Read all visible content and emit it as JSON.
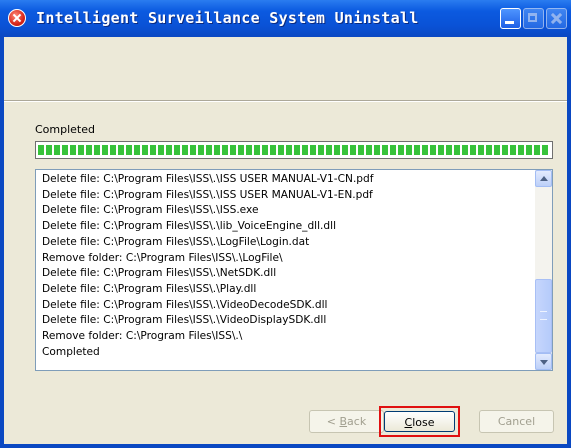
{
  "window": {
    "title": "Intelligent Surveillance System Uninstall",
    "icon": "uninstall-app-icon"
  },
  "status": {
    "text": "Completed",
    "progress": 1.0
  },
  "log": {
    "lines": [
      "Delete file: C:\\Program Files\\ISS\\.\\ISS USER MANUAL-V1-CN.pdf",
      "Delete file: C:\\Program Files\\ISS\\.\\ISS USER MANUAL-V1-EN.pdf",
      "Delete file: C:\\Program Files\\ISS\\.\\ISS.exe",
      "Delete file: C:\\Program Files\\ISS\\.\\lib_VoiceEngine_dll.dll",
      "Delete file: C:\\Program Files\\ISS\\.\\LogFile\\Login.dat",
      "Remove folder: C:\\Program Files\\ISS\\.\\LogFile\\",
      "Delete file: C:\\Program Files\\ISS\\.\\NetSDK.dll",
      "Delete file: C:\\Program Files\\ISS\\.\\Play.dll",
      "Delete file: C:\\Program Files\\ISS\\.\\VideoDecodeSDK.dll",
      "Delete file: C:\\Program Files\\ISS\\.\\VideoDisplaySDK.dll",
      "Remove folder: C:\\Program Files\\ISS\\.\\",
      "Completed"
    ]
  },
  "buttons": {
    "back": {
      "prefix": "< ",
      "mnemonic": "B",
      "rest": "ack"
    },
    "close": {
      "mnemonic": "C",
      "rest": "lose"
    },
    "cancel": "Cancel"
  },
  "colors": {
    "titlebar": "#0a52d6",
    "progress": "#37c23a",
    "highlight": "#e01010",
    "dialog": "#ece9d8"
  }
}
